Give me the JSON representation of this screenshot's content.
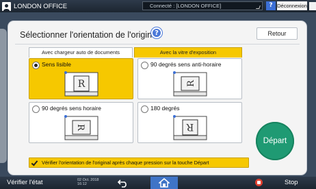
{
  "topbar": {
    "user": "LONDON OFFICE",
    "connection": "Connecté : [LONDON OFFICE]",
    "help": "?",
    "logout": "Déconnexion"
  },
  "dialog": {
    "title": "Sélectionner l'orientation de l'original",
    "help": "?",
    "back": "Retour",
    "tabs": [
      "Avec chargeur auto de documents",
      "Avec la vitre d'exposition"
    ],
    "active_tab": 1,
    "options": [
      {
        "label": "Sens lisible",
        "selected": true
      },
      {
        "label": "90 degrés sens anti-horaire",
        "selected": false
      },
      {
        "label": "90 degrés sens horaire",
        "selected": false
      },
      {
        "label": "180 degrés",
        "selected": false
      }
    ],
    "start": "Départ",
    "verify_label": "Vérifier l'orientation de l'original après chaque pression sur la touche Départ",
    "verify_checked": true
  },
  "bottombar": {
    "status": "Vérifier l'état",
    "date": "02 Oct. 2018",
    "time": "16:12",
    "stop": "Stop"
  },
  "colors": {
    "accent": "#f6c800",
    "start": "#1f9a73",
    "home": "#3f74c7"
  }
}
